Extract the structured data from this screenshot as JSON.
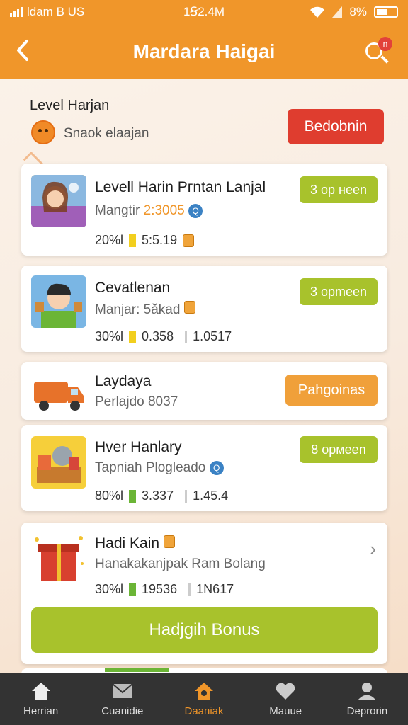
{
  "status_bar": {
    "carrier": "ldam B US",
    "time": "1Ꞩ2.4M",
    "battery": "8%"
  },
  "header": {
    "title": "Mardara Haigai",
    "notification_count": "n"
  },
  "level": {
    "title": "Level Harjan",
    "snack_text": "Snaok elaajan",
    "action_button": "Bedobnin"
  },
  "cards": [
    {
      "title": "Levell Harin Pгntan Lanjal",
      "subtitle_prefix": "Mangtir",
      "subtitle_highlight": "2:3005",
      "stat_label": "20%l",
      "stat_value": "5:5.19",
      "button": "3 op нeen"
    },
    {
      "title": "Cevatlenan",
      "subtitle_prefix": "Manjar: 5ăkad",
      "stat_label": "30%l",
      "stat_value": "0.358",
      "stat_value_2": "1.0517",
      "button": "3 opmeen"
    },
    {
      "title": "Laydaya",
      "subtitle_prefix": "Perlajdo 8037",
      "button": "Pahgoinas"
    },
    {
      "title": "Hver Hanlary",
      "subtitle_prefix": "Tapniah Plogleado",
      "stat_label": "80%l",
      "stat_value": "3.337",
      "stat_value_2": "1.45.4",
      "button": "8 opмeen"
    },
    {
      "title": "Hadi Kain",
      "subtitle_prefix": "Hanakakanjpak Ram Bolang",
      "stat_label": "30%l",
      "stat_value": "19536",
      "stat_value_2": "1N617",
      "button": "Hadjgih Bonus"
    }
  ],
  "bottom_nav": [
    {
      "label": "Herrian",
      "icon": "home-icon"
    },
    {
      "label": "Cuanidie",
      "icon": "mail-icon"
    },
    {
      "label": "Daaniak",
      "icon": "home-active-icon"
    },
    {
      "label": "Mauue",
      "icon": "heart-icon"
    },
    {
      "label": "Deprorin",
      "icon": "profile-icon"
    }
  ],
  "colors": {
    "primary": "#f0962a",
    "red": "#df3d2f",
    "green": "#a8c22c",
    "nav_bg": "#333333"
  }
}
